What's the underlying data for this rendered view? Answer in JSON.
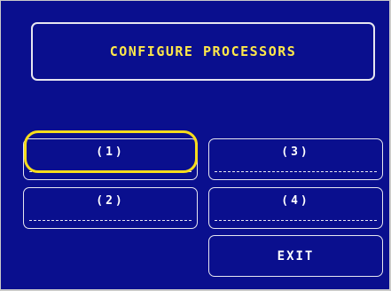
{
  "title": "CONFIGURE PROCESSORS",
  "buttons": {
    "p1": "(1)",
    "p2": "(2)",
    "p3": "(3)",
    "p4": "(4)",
    "exit": "EXIT"
  },
  "colors": {
    "background": "#0a0f8e",
    "title_text": "#ffe84a",
    "button_text": "#ffffff",
    "highlight": "#f7dc1c"
  }
}
